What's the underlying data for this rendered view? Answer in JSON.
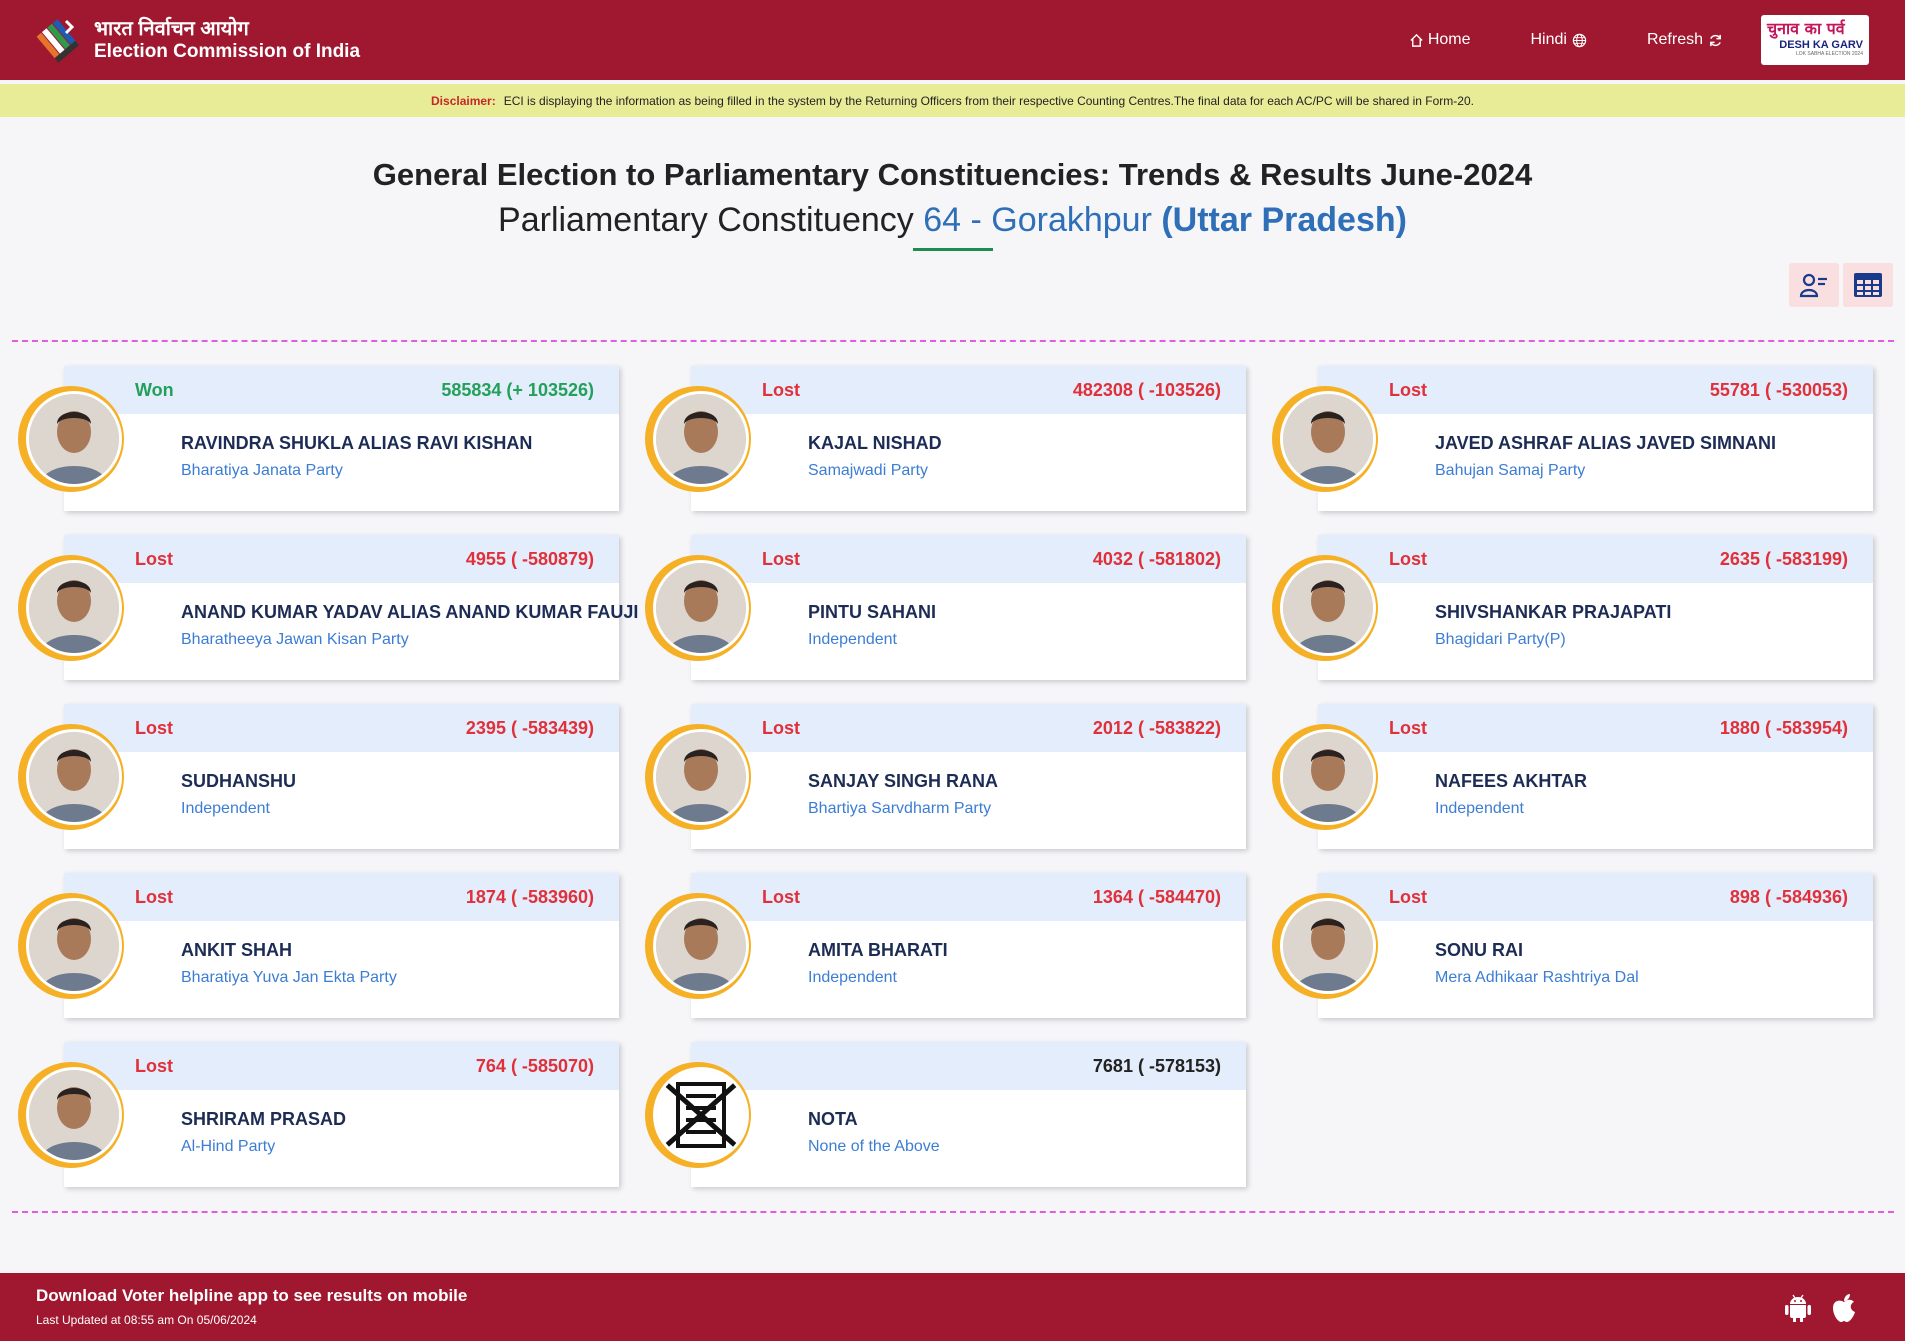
{
  "header": {
    "hindi_title": "भारत निर्वाचन आयोग",
    "english_title": "Election Commission of India",
    "nav": {
      "home": "Home",
      "hindi": "Hindi",
      "refresh": "Refresh"
    },
    "badge": {
      "hindi": "चुनाव का पर्व",
      "english": "DESH KA GARV",
      "sub": "LOK SABHA ELECTION 2024"
    }
  },
  "disclaimer": {
    "label": "Disclaimer:",
    "text": "ECI is displaying the information as being filled in the system by the Returning Officers from their respective Counting Centres.The final data for each AC/PC will be shared in Form-20."
  },
  "title": {
    "line1": "General Election to Parliamentary Constituencies: Trends & Results June-2024",
    "prefix": "Parliamentary Constituency",
    "pc": "64 - Gorakhpur",
    "state": "(Uttar Pradesh)"
  },
  "candidates": [
    {
      "status": "Won",
      "votes": "585834 (+ 103526)",
      "name": "RAVINDRA SHUKLA ALIAS RAVI KISHAN",
      "party": "Bharatiya Janata Party"
    },
    {
      "status": "Lost",
      "votes": "482308 ( -103526)",
      "name": "KAJAL NISHAD",
      "party": "Samajwadi Party"
    },
    {
      "status": "Lost",
      "votes": "55781 ( -530053)",
      "name": "JAVED ASHRAF ALIAS JAVED SIMNANI",
      "party": "Bahujan Samaj Party"
    },
    {
      "status": "Lost",
      "votes": "4955 ( -580879)",
      "name": "ANAND KUMAR YADAV ALIAS ANAND KUMAR FAUJI",
      "party": "Bharatheeya Jawan Kisan Party"
    },
    {
      "status": "Lost",
      "votes": "4032 ( -581802)",
      "name": "PINTU SAHANI",
      "party": "Independent"
    },
    {
      "status": "Lost",
      "votes": "2635 ( -583199)",
      "name": "SHIVSHANKAR PRAJAPATI",
      "party": "Bhagidari Party(P)"
    },
    {
      "status": "Lost",
      "votes": "2395 ( -583439)",
      "name": "SUDHANSHU",
      "party": "Independent"
    },
    {
      "status": "Lost",
      "votes": "2012 ( -583822)",
      "name": "SANJAY SINGH RANA",
      "party": "Bhartiya Sarvdharm Party"
    },
    {
      "status": "Lost",
      "votes": "1880 ( -583954)",
      "name": "NAFEES AKHTAR",
      "party": "Independent"
    },
    {
      "status": "Lost",
      "votes": "1874 ( -583960)",
      "name": "ANKIT SHAH",
      "party": "Bharatiya Yuva Jan Ekta Party"
    },
    {
      "status": "Lost",
      "votes": "1364 ( -584470)",
      "name": "AMITA BHARATI",
      "party": "Independent"
    },
    {
      "status": "Lost",
      "votes": "898 ( -584936)",
      "name": "SONU RAI",
      "party": "Mera Adhikaar Rashtriya Dal"
    },
    {
      "status": "Lost",
      "votes": "764 ( -585070)",
      "name": "SHRIRAM PRASAD",
      "party": "Al-Hind Party"
    },
    {
      "status": "",
      "votes": "7681 ( -578153)",
      "name": "NOTA",
      "party": "None of the Above"
    }
  ],
  "footer": {
    "main": "Download Voter helpline app to see results on mobile",
    "updated": "Last Updated at 08:55 am On 05/06/2024"
  },
  "colors": {
    "brand": "#a01830",
    "won": "#23a05a",
    "lost": "#e0303a",
    "party": "#3c7dd4",
    "ring": "#f5b025"
  }
}
